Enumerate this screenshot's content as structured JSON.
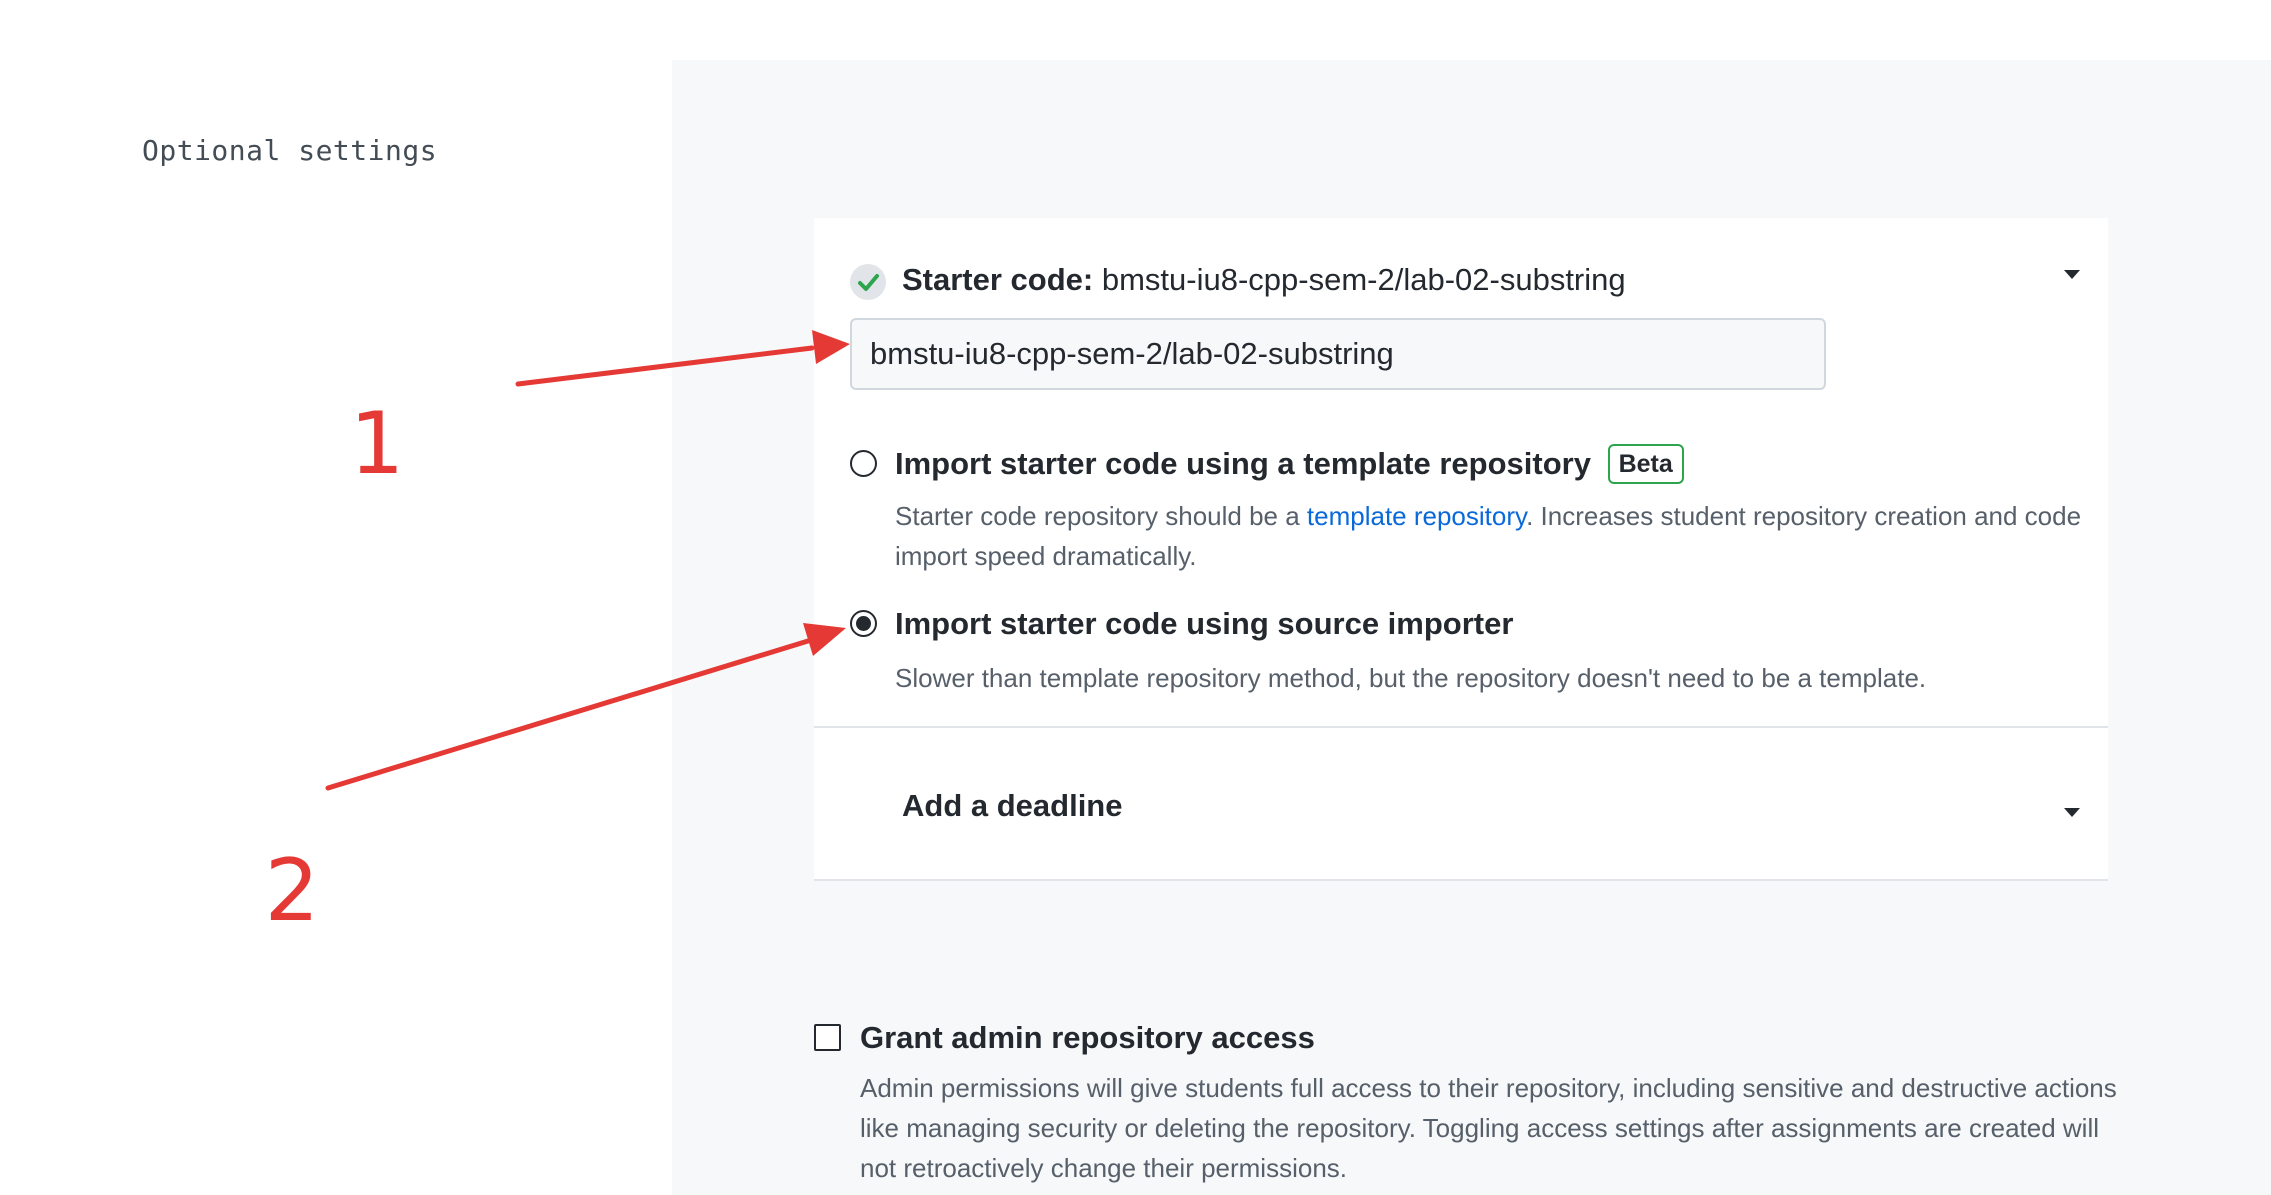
{
  "section_label": "Optional settings",
  "starter_code": {
    "title_label": "Starter code:",
    "title_value": "bmstu-iu8-cpp-sem-2/lab-02-substring",
    "input_value": "bmstu-iu8-cpp-sem-2/lab-02-substring",
    "options": [
      {
        "title": "Import starter code using a template repository",
        "badge": "Beta",
        "desc_before": "Starter code repository should be a ",
        "desc_link": "template repository",
        "desc_after": ". Increases student repository creation and code import speed dramatically.",
        "selected": false
      },
      {
        "title": "Import starter code using source importer",
        "desc": "Slower than template repository method, but the repository doesn't need to be a template.",
        "selected": true
      }
    ]
  },
  "deadline": {
    "label": "Add a deadline"
  },
  "admin_access": {
    "title": "Grant admin repository access",
    "desc": "Admin permissions will give students full access to their repository, including sensitive and destructive actions like managing security or deleting the repository. Toggling access settings after assignments are created will not retroactively change their permissions.",
    "checked": false
  },
  "annotations": {
    "label_1": "1",
    "label_2": "2",
    "color": "#e53935"
  },
  "colors": {
    "check": "#2da44e",
    "link": "#0969da",
    "panel_bg": "#f6f8fa"
  },
  "icons": [
    "check-circle-icon",
    "chevron-down-icon",
    "radio-icon",
    "checkbox-icon",
    "arrow-annotation-icon"
  ]
}
